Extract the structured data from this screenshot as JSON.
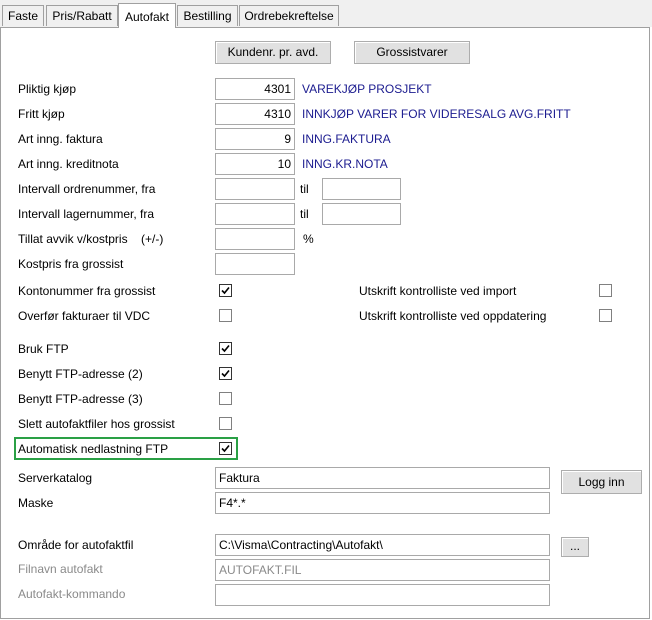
{
  "tabs": [
    {
      "label": "Faste"
    },
    {
      "label": "Pris/Rabatt"
    },
    {
      "label": "Autofakt"
    },
    {
      "label": "Bestilling"
    },
    {
      "label": "Ordrebekreftelse"
    }
  ],
  "buttons": {
    "kundenr": "Kundenr. pr. avd.",
    "grossistvarer": "Grossistvarer",
    "logg_inn": "Logg inn",
    "browse": "..."
  },
  "rows": {
    "pliktig_kjop": {
      "label": "Pliktig kjøp",
      "value": "4301",
      "desc": "VAREKJØP PROSJEKT"
    },
    "fritt_kjop": {
      "label": "Fritt kjøp",
      "value": "4310",
      "desc": "INNKJØP VARER FOR VIDERESALG AVG.FRITT"
    },
    "art_faktura": {
      "label": "Art inng. faktura",
      "value": "9",
      "desc": "INNG.FAKTURA"
    },
    "art_kreditnota": {
      "label": "Art inng. kreditnota",
      "value": "10",
      "desc": "INNG.KR.NOTA"
    },
    "intervall_ordre": {
      "label": "Intervall ordrenummer, fra",
      "til": "til",
      "from": "",
      "to": ""
    },
    "intervall_lager": {
      "label": "Intervall lagernummer, fra",
      "til": "til",
      "from": "",
      "to": ""
    },
    "tillat_avvik": {
      "label": "Tillat avvik v/kostpris",
      "hint": "(+/-)",
      "value": "",
      "unit": "%"
    },
    "kostpris": {
      "label": "Kostpris fra grossist",
      "value": ""
    }
  },
  "checkboxes": {
    "kontonummer": {
      "label": "Kontonummer fra grossist",
      "checked": true
    },
    "overfor_vdc": {
      "label": "Overfør fakturaer til VDC",
      "checked": false
    },
    "utskrift_import": {
      "label": "Utskrift kontrolliste ved import",
      "checked": false
    },
    "utskrift_oppdatering": {
      "label": "Utskrift kontrolliste ved oppdatering",
      "checked": false
    },
    "bruk_ftp": {
      "label": "Bruk FTP",
      "checked": true
    },
    "ftp2": {
      "label": "Benytt FTP-adresse (2)",
      "checked": true
    },
    "ftp3": {
      "label": "Benytt FTP-adresse (3)",
      "checked": false
    },
    "slett": {
      "label": "Slett autofaktfiler hos grossist",
      "checked": false
    },
    "auto_nedlast": {
      "label": "Automatisk nedlastning FTP",
      "checked": true
    }
  },
  "server": {
    "katalog_label": "Serverkatalog",
    "katalog_value": "Faktura",
    "maske_label": "Maske",
    "maske_value": "F4*.*"
  },
  "autofakt": {
    "omrade_label": "Område for autofaktfil",
    "omrade_value": "C:\\Visma\\Contracting\\Autofakt\\",
    "filnavn_label": "Filnavn autofakt",
    "filnavn_value": "AUTOFAKT.FIL",
    "kommando_label": "Autofakt-kommando",
    "kommando_value": ""
  },
  "colors": {
    "highlight": "#2aa045",
    "description_text": "#1b1b8f"
  }
}
